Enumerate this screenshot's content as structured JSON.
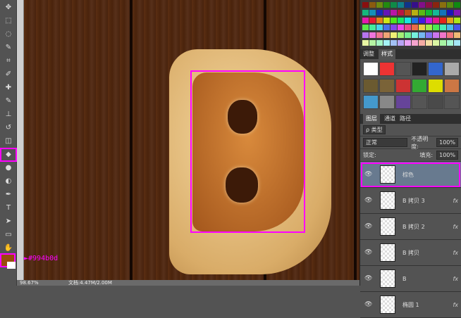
{
  "tools": [
    "move",
    "marquee",
    "lasso",
    "quick-select",
    "crop",
    "eyedropper",
    "healing",
    "brush",
    "stamp",
    "history-brush",
    "eraser",
    "paint-bucket",
    "blur",
    "dodge",
    "pen",
    "type",
    "path-select",
    "shape",
    "hand",
    "zoom"
  ],
  "foreground_color": "#994b0d",
  "annotation": "►#994b0d",
  "status": {
    "zoom": "98.67%",
    "doc": "文档:4.47M/2.00M"
  },
  "panel_tabs_top": [
    "调整",
    "样式"
  ],
  "layers_tabs": [
    "图层",
    "通道",
    "路径"
  ],
  "filter_label": "ρ 类型",
  "blend_mode": "正常",
  "opacity_label": "不透明度:",
  "opacity_value": "100%",
  "lock_label": "锁定:",
  "fill_label": "填充:",
  "fill_value": "100%",
  "layers": [
    {
      "name": "棕色",
      "fx": "",
      "selected": true
    },
    {
      "name": "B 拷贝 3",
      "fx": "fx"
    },
    {
      "name": "B 拷贝 2",
      "fx": "fx"
    },
    {
      "name": "B 拷贝",
      "fx": "fx"
    },
    {
      "name": "B",
      "fx": "fx"
    },
    {
      "name": "椭圆 1",
      "fx": "fx"
    }
  ]
}
